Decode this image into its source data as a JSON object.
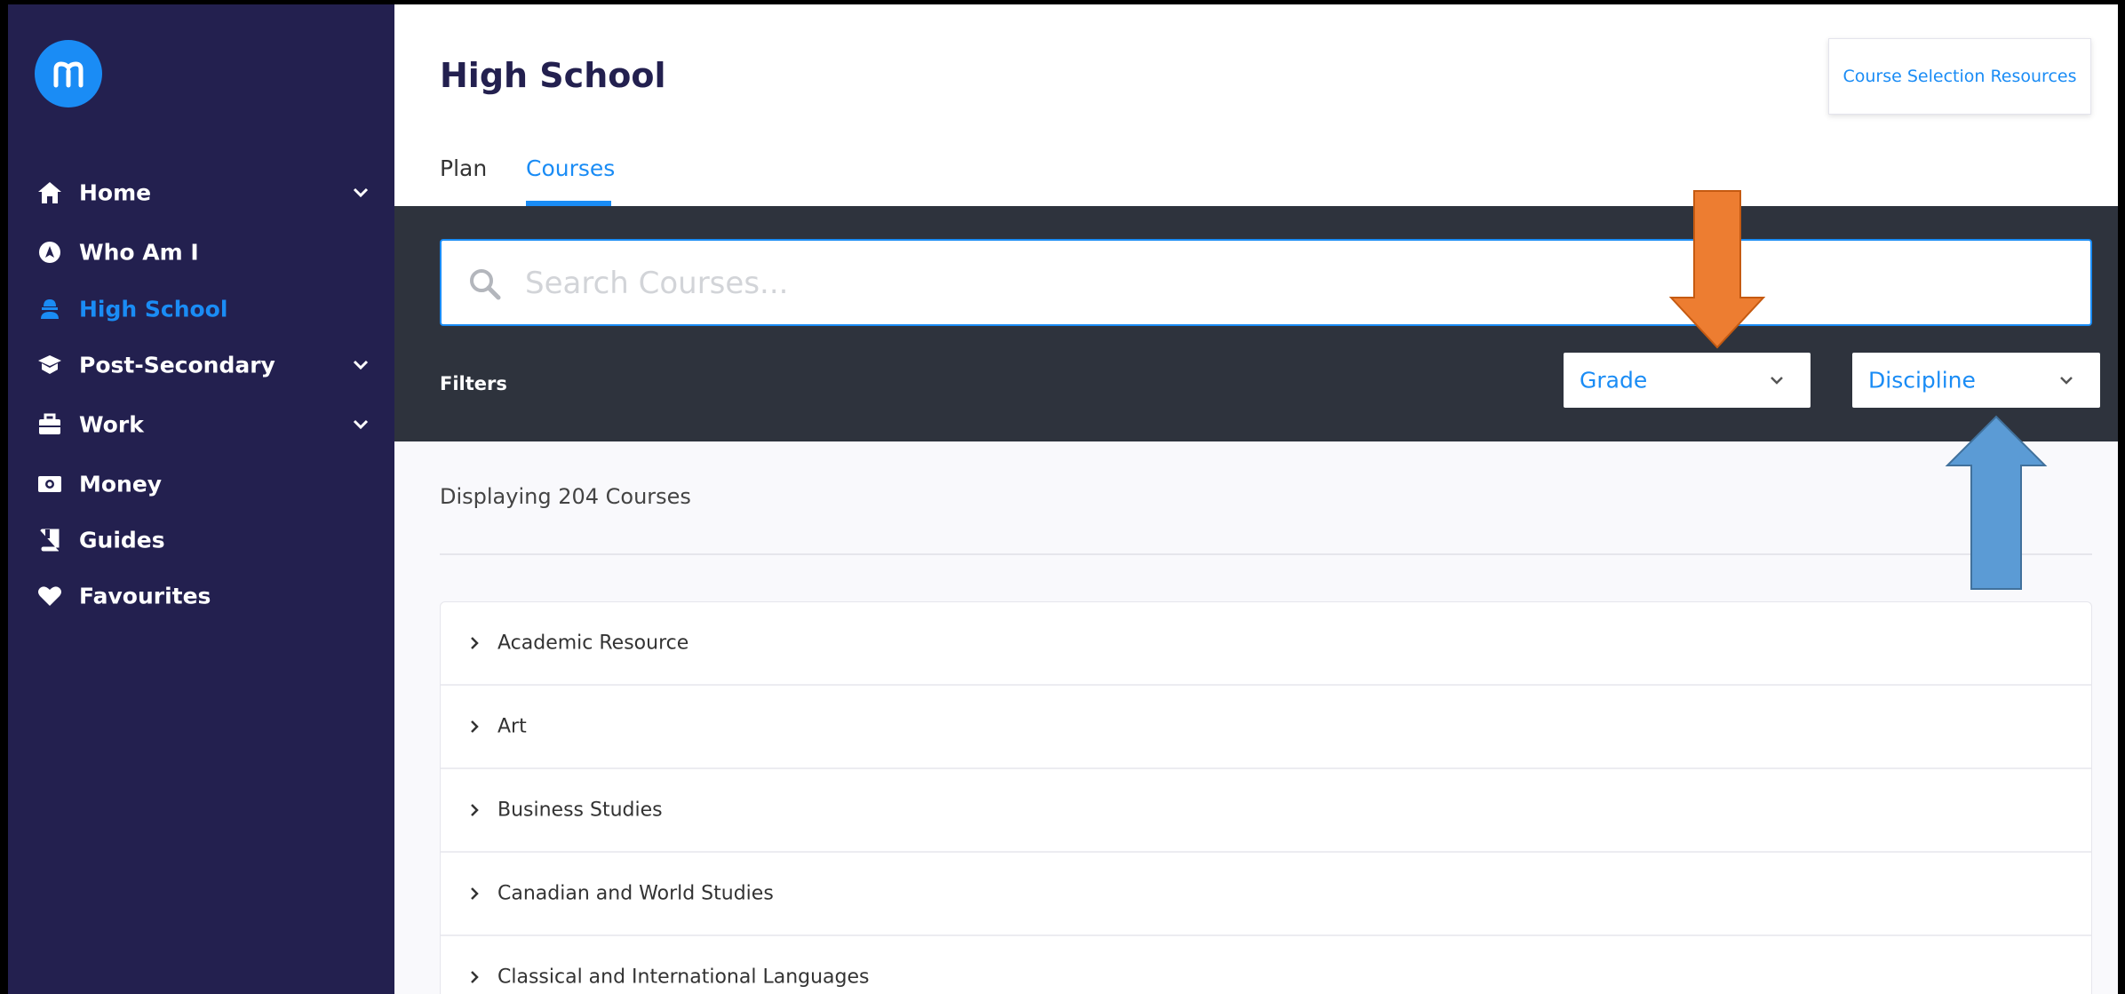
{
  "sidebar": {
    "items": [
      {
        "label": "Home",
        "icon": "home-icon",
        "has_submenu": true
      },
      {
        "label": "Who Am I",
        "icon": "compass-icon",
        "has_submenu": false
      },
      {
        "label": "High School",
        "icon": "student-icon",
        "has_submenu": false,
        "active": true
      },
      {
        "label": "Post-Secondary",
        "icon": "graduation-cap-icon",
        "has_submenu": true
      },
      {
        "label": "Work",
        "icon": "briefcase-icon",
        "has_submenu": true
      },
      {
        "label": "Money",
        "icon": "money-icon",
        "has_submenu": false
      },
      {
        "label": "Guides",
        "icon": "book-icon",
        "has_submenu": false
      },
      {
        "label": "Favourites",
        "icon": "heart-icon",
        "has_submenu": false
      }
    ]
  },
  "header": {
    "title": "High School",
    "resources_button": "Course Selection Resources",
    "tabs": [
      {
        "label": "Plan",
        "active": false
      },
      {
        "label": "Courses",
        "active": true
      }
    ]
  },
  "search": {
    "placeholder": "Search Courses..."
  },
  "filters": {
    "label": "Filters",
    "grade": "Grade",
    "discipline": "Discipline"
  },
  "results": {
    "count_text": "Displaying 204 Courses",
    "courses": [
      "Academic Resource",
      "Art",
      "Business Studies",
      "Canadian and World Studies",
      "Classical and International Languages"
    ]
  },
  "colors": {
    "sidebar_bg": "#23204f",
    "accent": "#1a8cf5",
    "filter_bar_bg": "#2e333d",
    "annotation_orange": "#ed7d31",
    "annotation_blue": "#5b9bd5"
  }
}
